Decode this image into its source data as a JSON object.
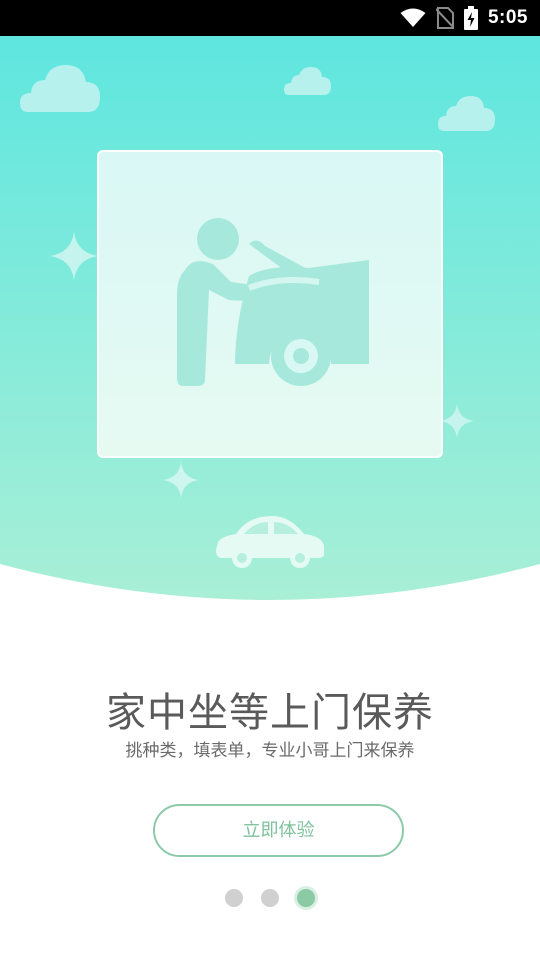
{
  "status_bar": {
    "time": "5:05",
    "icons": [
      "wifi-icon",
      "no-sim-icon",
      "battery-charging-icon"
    ]
  },
  "hero": {
    "illustration": "mechanic-repairing-car-icon",
    "colors": {
      "top": "#5ee6df",
      "bottom": "#a5eed8",
      "card": "#dcf8f3"
    }
  },
  "onboarding": {
    "headline": "家中坐等上门保养",
    "subline": "挑种类，填表单，专业小哥上门来保养",
    "cta_label": "立即体验"
  },
  "pager": {
    "total": 3,
    "active_index": 2,
    "active_color": "#8ccaa6",
    "inactive_color": "#d0d0d0"
  }
}
